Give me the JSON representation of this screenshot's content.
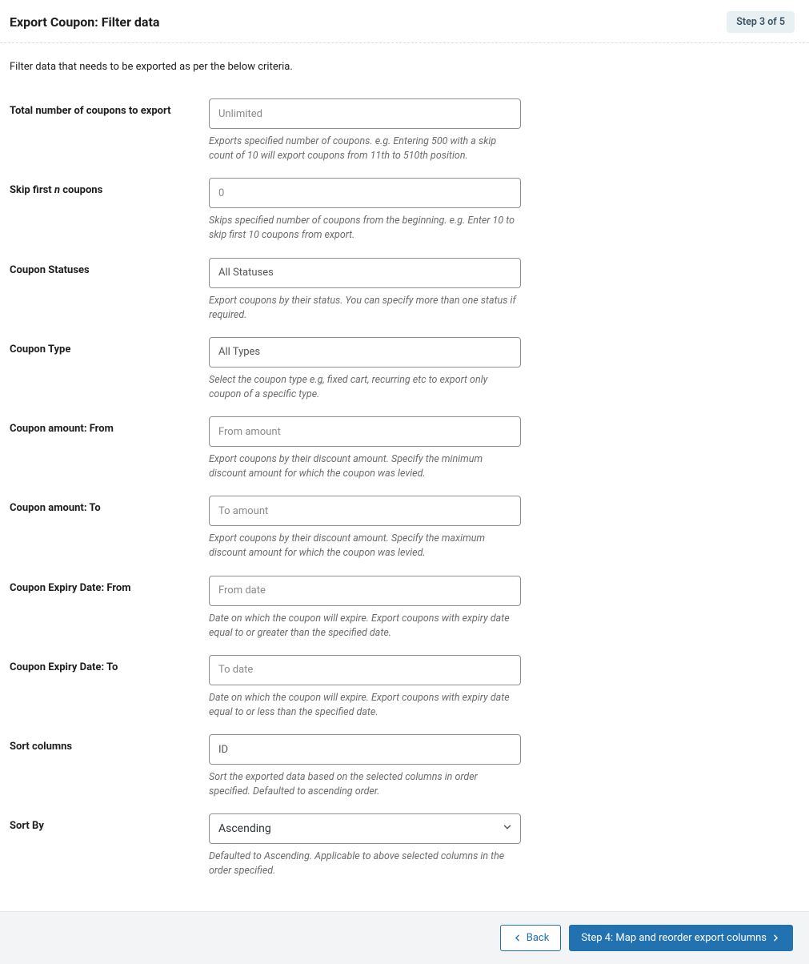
{
  "header": {
    "title": "Export Coupon: Filter data",
    "step_badge": "Step 3 of 5"
  },
  "intro": "Filter data that needs to be exported as per the below criteria.",
  "fields": {
    "total": {
      "label": "Total number of coupons to export",
      "placeholder": "Unlimited",
      "value": "",
      "help": "Exports specified number of coupons. e.g. Entering 500 with a skip count of 10 will export coupons from 11th to 510th position."
    },
    "skip": {
      "label_prefix": "Skip first ",
      "label_n": "n",
      "label_suffix": " coupons",
      "placeholder": "0",
      "value": "",
      "help": "Skips specified number of coupons from the beginning. e.g. Enter 10 to skip first 10 coupons from export."
    },
    "statuses": {
      "label": "Coupon Statuses",
      "placeholder": "All Statuses",
      "help": "Export coupons by their status. You can specify more than one status if required."
    },
    "type": {
      "label": "Coupon Type",
      "placeholder": "All Types",
      "help": "Select the coupon type e.g, fixed cart, recurring etc to export only coupon of a specific type."
    },
    "amount_from": {
      "label": "Coupon amount: From",
      "placeholder": "From amount",
      "value": "",
      "help": "Export coupons by their discount amount. Specify the minimum discount amount for which the coupon was levied."
    },
    "amount_to": {
      "label": "Coupon amount: To",
      "placeholder": "To amount",
      "value": "",
      "help": "Export coupons by their discount amount. Specify the maximum discount amount for which the coupon was levied."
    },
    "expiry_from": {
      "label": "Coupon Expiry Date: From",
      "placeholder": "From date",
      "value": "",
      "help": "Date on which the coupon will expire. Export coupons with expiry date equal to or greater than the specified date."
    },
    "expiry_to": {
      "label": "Coupon Expiry Date: To",
      "placeholder": "To date",
      "value": "",
      "help": "Date on which the coupon will expire. Export coupons with expiry date equal to or less than the specified date."
    },
    "sort_columns": {
      "label": "Sort columns",
      "placeholder": "ID",
      "help": "Sort the exported data based on the selected columns in order specified. Defaulted to ascending order."
    },
    "sort_by": {
      "label": "Sort By",
      "value": "Ascending",
      "help": "Defaulted to Ascending. Applicable to above selected columns in the order specified."
    }
  },
  "footer": {
    "back": "Back",
    "next": "Step 4: Map and reorder export columns"
  }
}
